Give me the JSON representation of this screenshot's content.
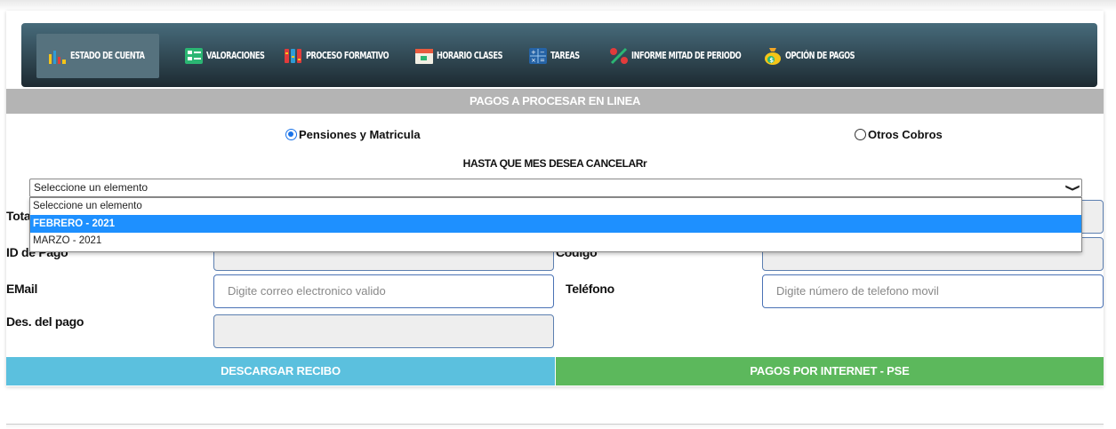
{
  "nav": {
    "items": [
      {
        "label": "ESTADO DE CUENTA",
        "icon": "bar-chart-icon"
      },
      {
        "label": "VALORACIONES",
        "icon": "checklist-icon"
      },
      {
        "label": "PROCESO FORMATIVO",
        "icon": "columns-icon"
      },
      {
        "label": "HORARIO CLASES",
        "icon": "calendar-icon"
      },
      {
        "label": "TAREAS",
        "icon": "calculator-icon"
      },
      {
        "label": "INFORME MITAD DE PERIODO",
        "icon": "percent-icon"
      },
      {
        "label": "OPCIÓN DE PAGOS",
        "icon": "money-bag-icon"
      }
    ]
  },
  "section_title": "PAGOS A PROCESAR EN LINEA",
  "radios": {
    "pensiones": "Pensiones y Matricula",
    "otros": "Otros Cobros"
  },
  "question": "HASTA QUE MES DESEA CANCELARr",
  "select": {
    "value": "Seleccione un elemento",
    "options": [
      "Seleccione un elemento",
      "FEBRERO - 2021",
      "MARZO - 2021"
    ]
  },
  "form": {
    "total_label": "Tota",
    "id_pago_label": "ID de Pago",
    "codigo_label": "Código",
    "email_label": "EMail",
    "email_placeholder": "Digite correo electronico valido",
    "telefono_label": "Teléfono",
    "telefono_placeholder": "Digite número de telefono movil",
    "descripcion_label": "Des. del pago"
  },
  "buttons": {
    "descargar": "DESCARGAR RECIBO",
    "pse": "PAGOS POR INTERNET - PSE"
  },
  "colors": {
    "accent_blue": "#5bc0de",
    "accent_green": "#5cb85c",
    "selected_option": "#1e90ff"
  }
}
